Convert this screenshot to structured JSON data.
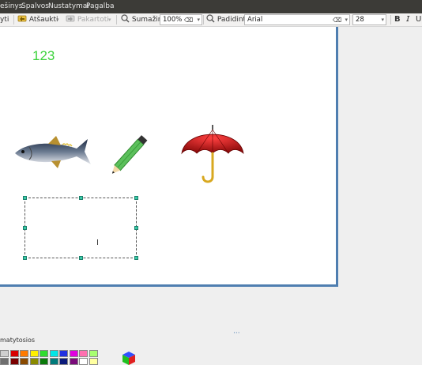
{
  "menu": [
    "ešinys",
    "Spalvos",
    "Nustatymai",
    "Pagalba"
  ],
  "toolbar": {
    "first_label": "yti",
    "undo_label": "Atšaukti",
    "redo_label": "Pakartoti",
    "zoom_out_label": "Sumažinti",
    "zoom_value": "100%",
    "zoom_in_label": "Padidinti",
    "font_name": "Arial",
    "font_size": "28"
  },
  "canvas": {
    "text": "123"
  },
  "palette": {
    "label": "matytosios",
    "colors_row1": [
      "#cfcfcf",
      "#d80000",
      "#ff7a00",
      "#ffef00",
      "#2fdc2f",
      "#00e6e6",
      "#2030e0",
      "#e000e0",
      "#ff6fb0",
      "#a8ff70"
    ],
    "colors_row2": [
      "#6f6f6f",
      "#7a0000",
      "#8a4a00",
      "#8a8a00",
      "#0a7a0a",
      "#007a7a",
      "#0a1a7a",
      "#7a0a7a",
      "#ffffff",
      "#ffffa0"
    ]
  }
}
